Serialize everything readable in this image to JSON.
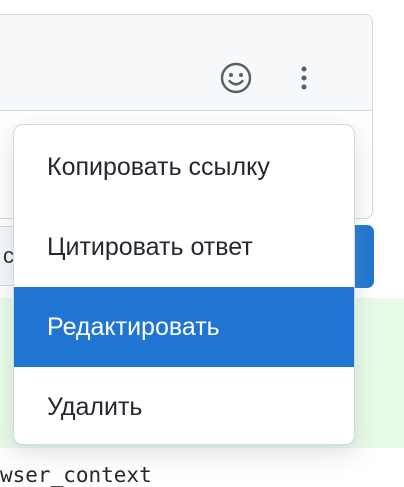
{
  "colors": {
    "accent": "#1f75d1",
    "menu_text": "#24292f",
    "menu_active_text": "#ffffff",
    "border": "#d0d7de",
    "header_bg": "#f6f8fa",
    "diff_added_bg": "#e8fbe8"
  },
  "comment": {
    "header_icons": [
      "smiley-icon",
      "kebab-icon"
    ]
  },
  "left_button": {
    "visible_glyph": "c"
  },
  "dropdown": {
    "items": [
      {
        "label": "Копировать ссылку",
        "active": false
      },
      {
        "label": "Цитировать ответ",
        "active": false
      },
      {
        "label": "Редактировать",
        "active": true
      },
      {
        "label": "Удалить",
        "active": false
      }
    ]
  },
  "code": {
    "visible_text": "wser_context"
  }
}
